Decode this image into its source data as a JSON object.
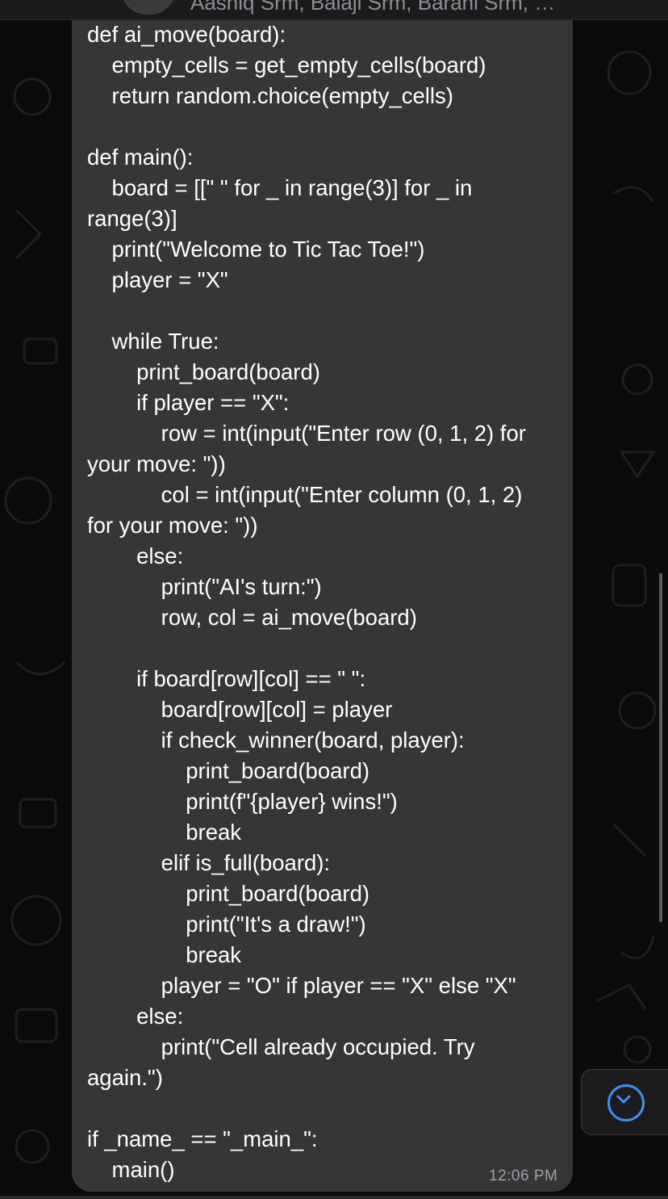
{
  "header": {
    "group_members": "Aashiq Srm, Balaji Srm, Barani Srm, Ga..."
  },
  "message": {
    "code_lines": [
      "def ai_move(board):",
      "    empty_cells = get_empty_cells(board)",
      "    return random.choice(empty_cells)",
      "",
      "def main():",
      "    board = [[\" \" for _ in range(3)] for _ in",
      "range(3)]",
      "    print(\"Welcome to Tic Tac Toe!\")",
      "    player = \"X\"",
      "",
      "    while True:",
      "        print_board(board)",
      "        if player == \"X\":",
      "            row = int(input(\"Enter row (0, 1, 2) for",
      "your move: \"))",
      "            col = int(input(\"Enter column (0, 1, 2)",
      "for your move: \"))",
      "        else:",
      "            print(\"AI's turn:\")",
      "            row, col = ai_move(board)",
      "",
      "        if board[row][col] == \" \":",
      "            board[row][col] = player",
      "            if check_winner(board, player):",
      "                print_board(board)",
      "                print(f\"{player} wins!\")",
      "                break",
      "            elif is_full(board):",
      "                print_board(board)",
      "                print(\"It's a draw!\")",
      "                break",
      "            player = \"O\" if player == \"X\" else \"X\"",
      "        else:",
      "            print(\"Cell already occupied. Try",
      "again.\")",
      "",
      "if _name_ == \"_main_\":",
      "    main()"
    ],
    "timestamp": "12:06 PM"
  },
  "icons": {
    "scroll_down": "chevron-down-icon",
    "accent": "#3d8ff5"
  }
}
